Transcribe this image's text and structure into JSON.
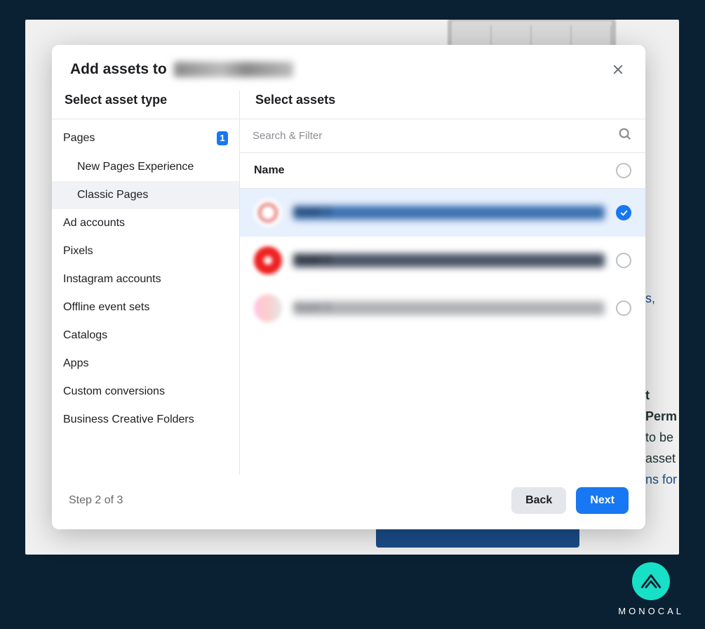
{
  "header": {
    "title_prefix": "Add assets to",
    "account_name_redacted": "Redacted Account"
  },
  "sidebar": {
    "heading": "Select asset type",
    "items": [
      {
        "label": "Pages",
        "badge": "1"
      },
      {
        "label": "New Pages Experience",
        "sub": true
      },
      {
        "label": "Classic Pages",
        "sub": true,
        "selected": true
      },
      {
        "label": "Ad accounts"
      },
      {
        "label": "Pixels"
      },
      {
        "label": "Instagram accounts"
      },
      {
        "label": "Offline event sets"
      },
      {
        "label": "Catalogs"
      },
      {
        "label": "Apps"
      },
      {
        "label": "Custom conversions"
      },
      {
        "label": "Business Creative Folders"
      }
    ]
  },
  "assets": {
    "heading": "Select assets",
    "search_placeholder": "Search & Filter",
    "name_column": "Name",
    "rows": [
      {
        "name_redacted": "Asset 1",
        "selected": true
      },
      {
        "name_redacted": "Asset 2",
        "selected": false
      },
      {
        "name_redacted": "Asset 3",
        "selected": false
      }
    ]
  },
  "footer": {
    "step_text": "Step 2 of 3",
    "back_label": "Back",
    "next_label": "Next"
  },
  "brand": {
    "name": "MONOCAL"
  },
  "colors": {
    "accent": "#1877f2",
    "page_bg": "#0a2033",
    "brand": "#18e0c6"
  },
  "background_partial_text": {
    "heading_fragment": "t Perm",
    "line1": "to be",
    "line2": "asset",
    "line3": "ns for",
    "link_fragment": "s,"
  }
}
